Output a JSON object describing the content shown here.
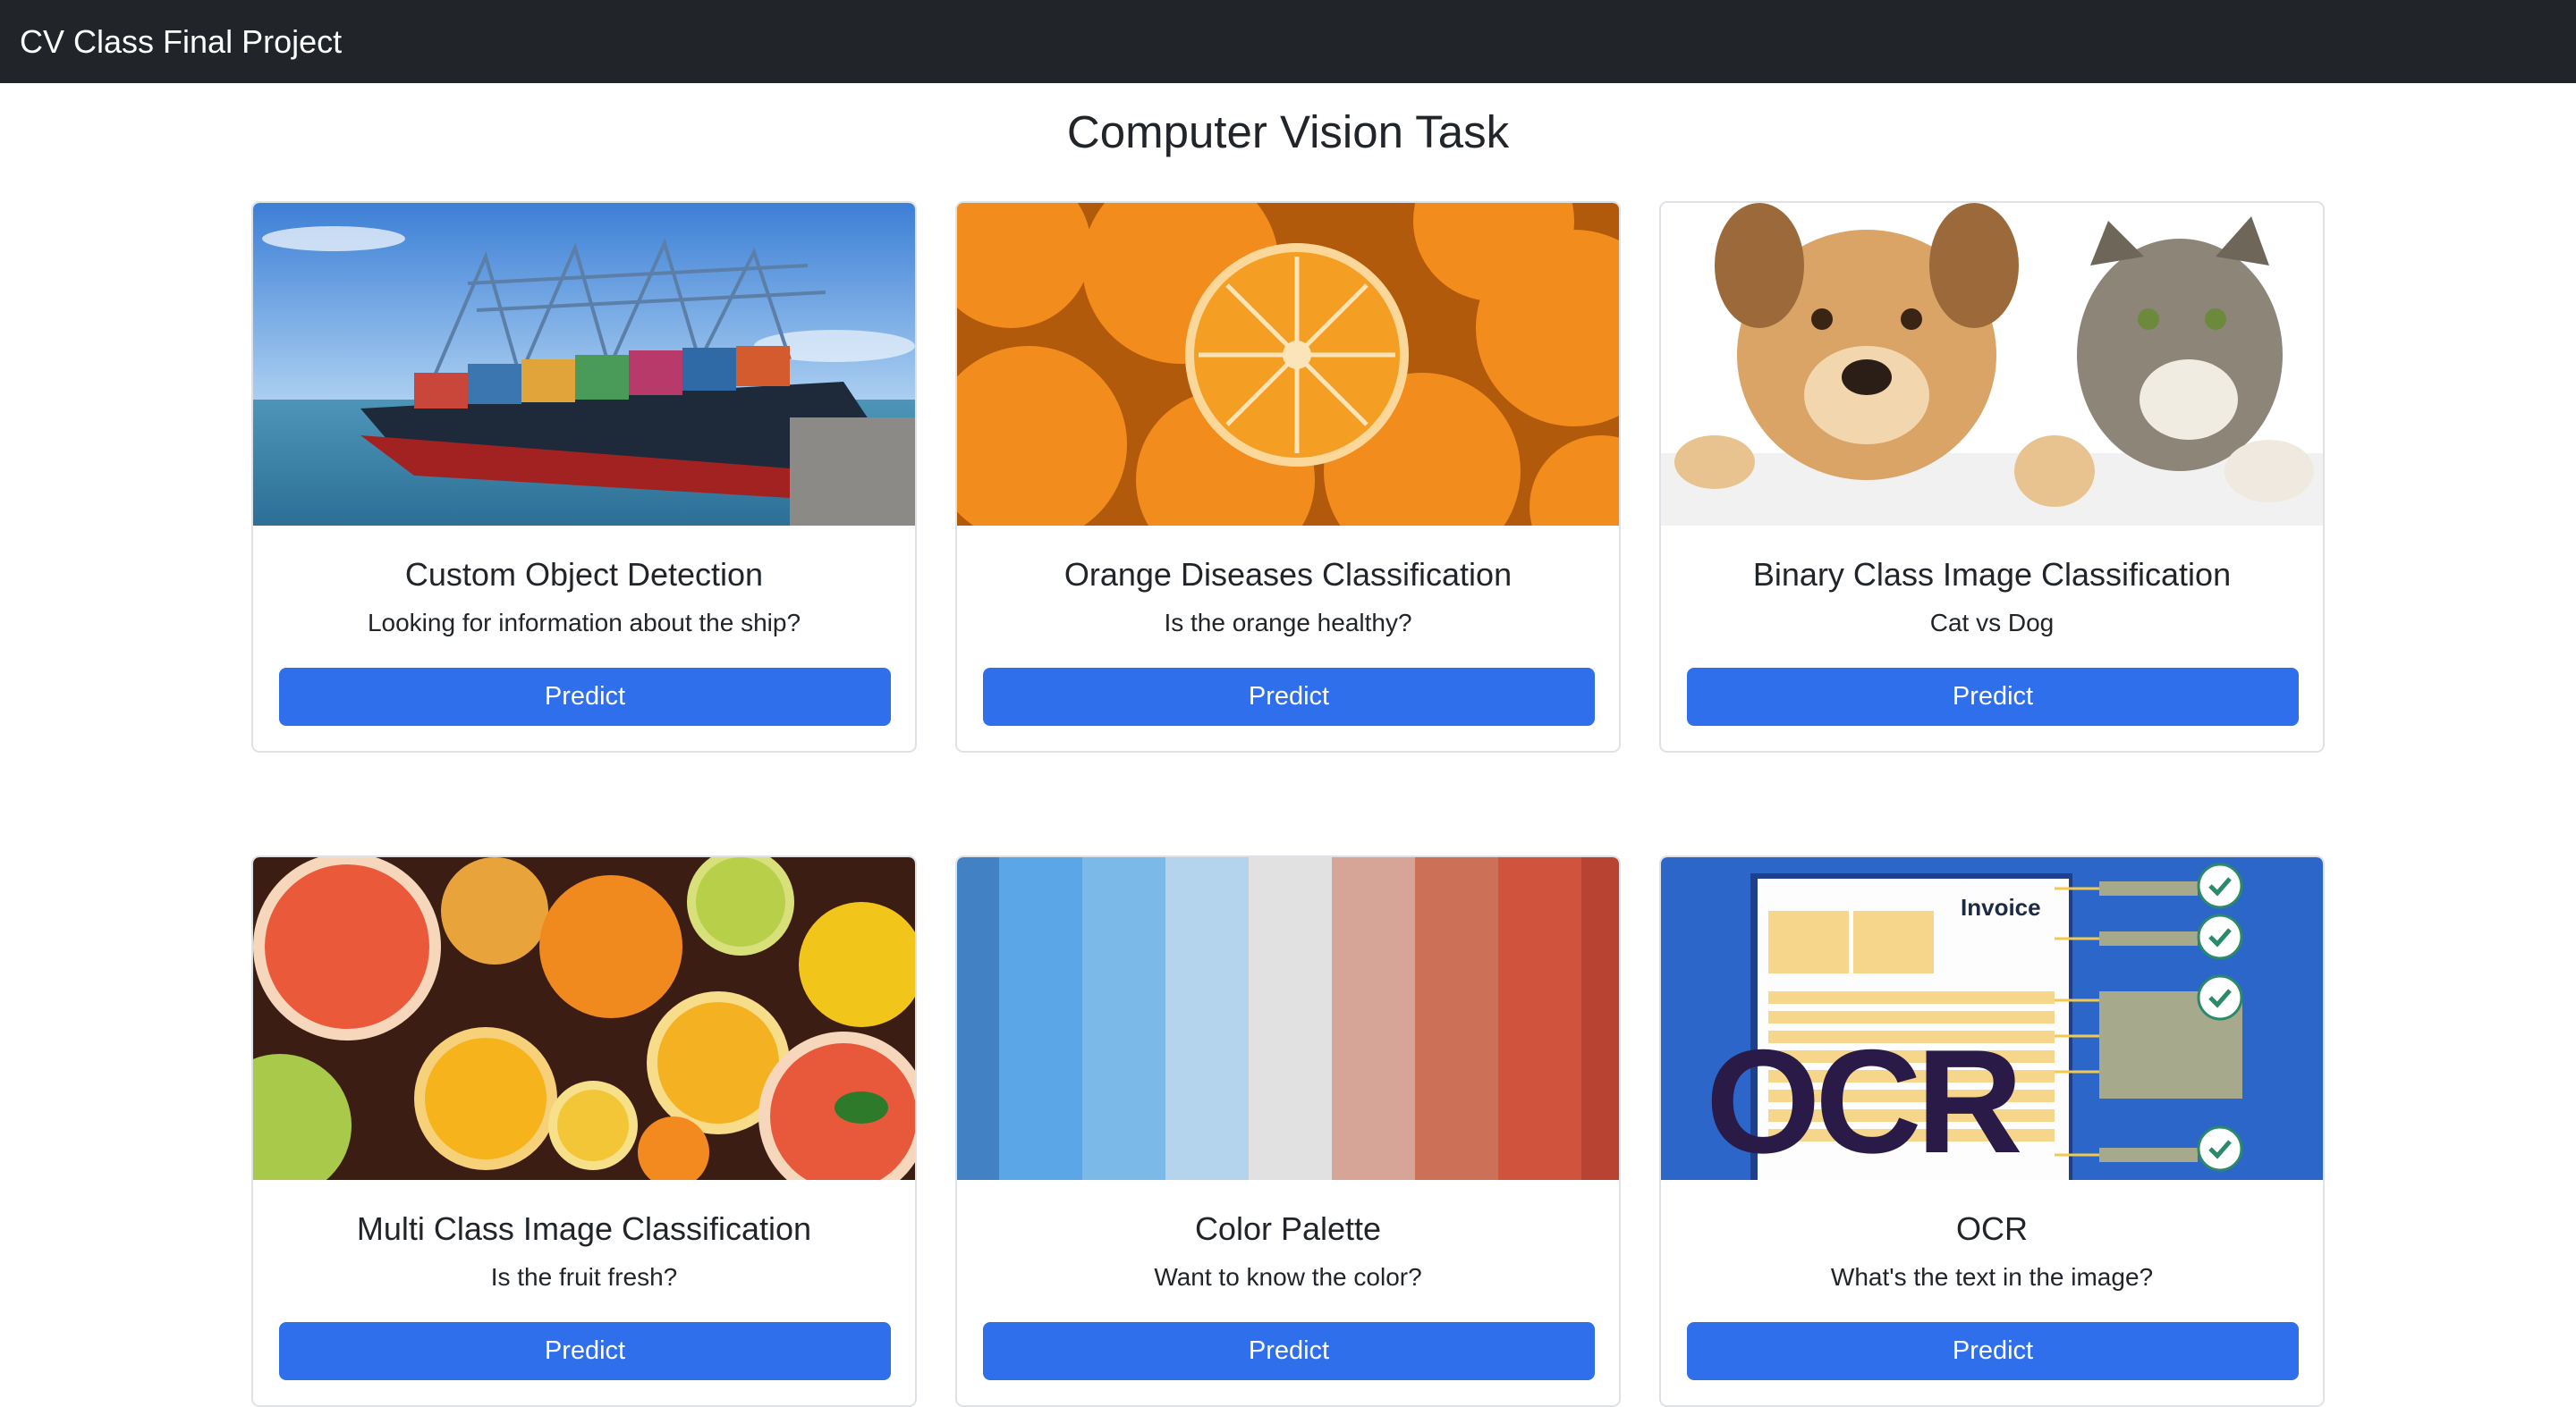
{
  "navbar": {
    "brand": "CV Class Final Project"
  },
  "page": {
    "title": "Computer Vision Task"
  },
  "cards": [
    {
      "title": "Custom Object Detection",
      "text": "Looking for information about the ship?",
      "button": "Predict",
      "image": "cargo-ship-port"
    },
    {
      "title": "Orange Diseases Classification",
      "text": "Is the orange healthy?",
      "button": "Predict",
      "image": "oranges"
    },
    {
      "title": "Binary Class Image Classification",
      "text": "Cat vs Dog",
      "button": "Predict",
      "image": "dog-and-cat"
    },
    {
      "title": "Multi Class Image Classification",
      "text": "Is the fruit fresh?",
      "button": "Predict",
      "image": "citrus-fruits"
    },
    {
      "title": "Color Palette",
      "text": "Want to know the color?",
      "button": "Predict",
      "image": "color-stripes"
    },
    {
      "title": "OCR",
      "text": "What's the text in the image?",
      "button": "Predict",
      "image": "ocr-invoice",
      "image_text": {
        "logo": "OCR",
        "doc": "Invoice"
      }
    }
  ],
  "colors": {
    "navbar": "#212529",
    "button": "#2f6fec",
    "palette": [
      "#4181c4",
      "#5aa6e6",
      "#7ab9e8",
      "#b3d4ec",
      "#e1e1e1",
      "#d7a597",
      "#cd7058",
      "#cf533d",
      "#b94332"
    ]
  }
}
